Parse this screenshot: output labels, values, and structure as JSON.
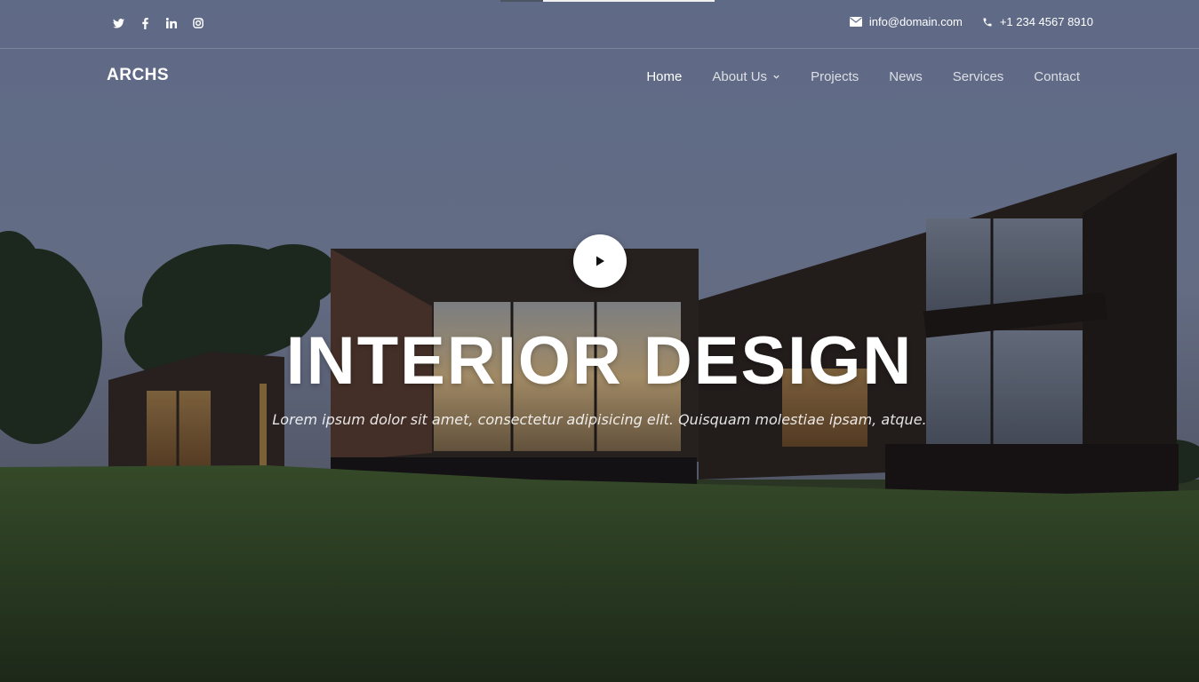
{
  "topbar": {
    "social": [
      {
        "name": "twitter",
        "glyph": "t"
      },
      {
        "name": "facebook",
        "glyph": "f"
      },
      {
        "name": "linkedin",
        "glyph": "in"
      },
      {
        "name": "instagram",
        "glyph": "◎"
      }
    ],
    "email": "info@domain.com",
    "phone": "+1 234 4567 8910"
  },
  "brand": {
    "logo": "ARCHS"
  },
  "nav": {
    "items": [
      {
        "label": "Home",
        "active": true
      },
      {
        "label": "About Us",
        "dropdown": true
      },
      {
        "label": "Projects"
      },
      {
        "label": "News"
      },
      {
        "label": "Services"
      },
      {
        "label": "Contact"
      }
    ]
  },
  "hero": {
    "title": "INTERIOR DESIGN",
    "subtitle": "Lorem ipsum dolor sit amet, consectetur adipisicing elit. Quisquam molestiae ipsam, atque."
  },
  "colors": {
    "sky": "#6b7793",
    "grass": "#2e3d22",
    "building": "#2a211d",
    "text": "#ffffff"
  }
}
